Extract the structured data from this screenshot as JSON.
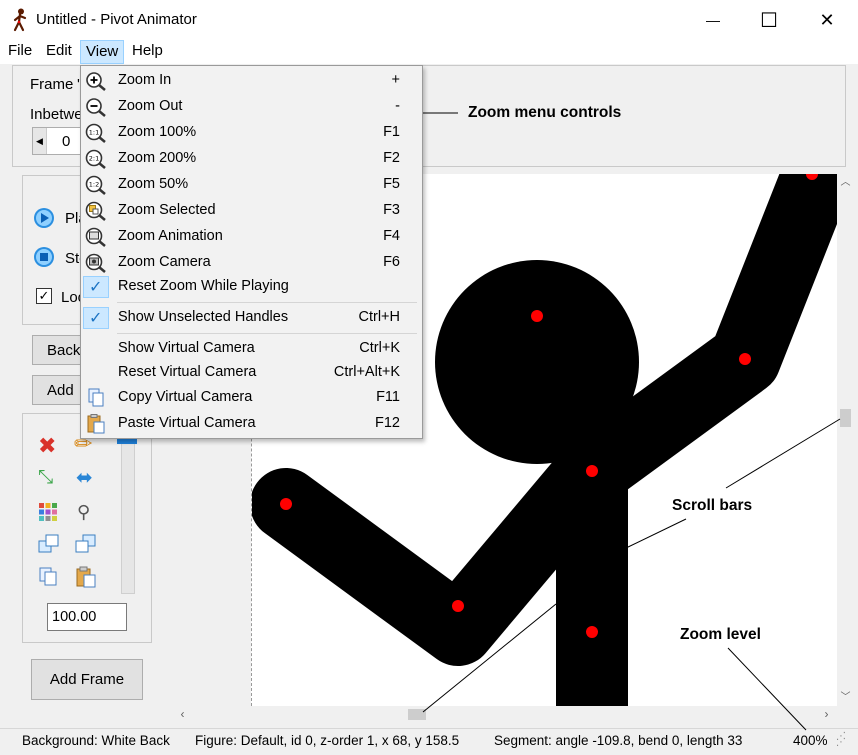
{
  "window": {
    "title": "Untitled - Pivot Animator",
    "minimize_glyph": "—",
    "maximize_glyph": "☐",
    "close_glyph": "✕"
  },
  "menubar": [
    "File",
    "Edit",
    "View",
    "Help"
  ],
  "view_menu": {
    "items": [
      {
        "label": "Zoom In",
        "shortcut": "+",
        "icon": "zoom-in-icon"
      },
      {
        "label": "Zoom Out",
        "shortcut": "-",
        "icon": "zoom-out-icon"
      },
      {
        "label": "Zoom 100%",
        "shortcut": "F1",
        "icon": "zoom-100-icon",
        "badge": "1:1"
      },
      {
        "label": "Zoom 200%",
        "shortcut": "F2",
        "icon": "zoom-200-icon",
        "badge": "2:1"
      },
      {
        "label": "Zoom 50%",
        "shortcut": "F5",
        "icon": "zoom-50-icon",
        "badge": "1:2"
      },
      {
        "label": "Zoom Selected",
        "shortcut": "F3",
        "icon": "zoom-selected-icon"
      },
      {
        "label": "Zoom Animation",
        "shortcut": "F4",
        "icon": "zoom-animation-icon"
      },
      {
        "label": "Zoom Camera",
        "shortcut": "F6",
        "icon": "zoom-camera-icon"
      },
      {
        "label": "Reset Zoom While Playing",
        "shortcut": "",
        "icon": "check-icon",
        "checked": true
      },
      {
        "label": "Show Unselected Handles",
        "shortcut": "Ctrl+H",
        "icon": "check-icon",
        "checked": true
      },
      {
        "label": "Show Virtual Camera",
        "shortcut": "Ctrl+K",
        "icon": ""
      },
      {
        "label": "Reset Virtual Camera",
        "shortcut": "Ctrl+Alt+K",
        "icon": ""
      },
      {
        "label": "Copy Virtual Camera",
        "shortcut": "F11",
        "icon": "copy-camera-icon"
      },
      {
        "label": "Paste Virtual Camera",
        "shortcut": "F12",
        "icon": "paste-camera-icon"
      }
    ]
  },
  "left_panel": {
    "frame_label": "Frame",
    "frame_tail": "'",
    "inbetween_label": "Inbetwe",
    "inbetween_value": "0",
    "play_label": "Pla",
    "stop_label": "Sto",
    "loop_label": "Loo",
    "loop_checked": true,
    "back_button": "Back",
    "add_button": "Add",
    "scale_value": "100.00",
    "add_frame_button": "Add Frame"
  },
  "status": {
    "background": "Background: White Back",
    "figure": "Figure: Default,  id 0,  z-order 1,  x 68, y 158.5",
    "segment": "Segment: angle -109.8,  bend 0,  length 33",
    "zoom": "400%"
  },
  "annotations": {
    "zoom_menu": "Zoom menu controls",
    "scroll_bars": "Scroll bars",
    "zoom_level": "Zoom level"
  },
  "colors": {
    "menu_highlight": "#cce8ff",
    "handle": "#ff0000",
    "figure": "#000000"
  }
}
